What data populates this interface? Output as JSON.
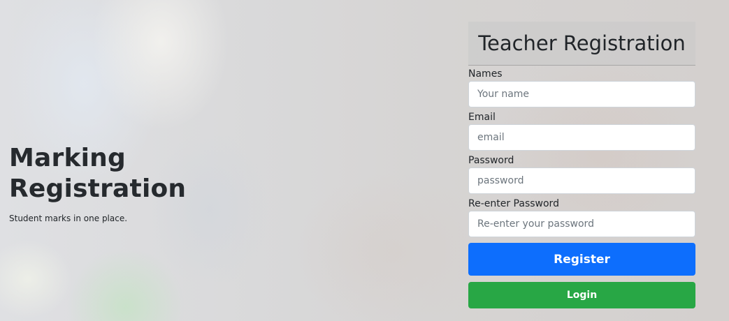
{
  "hero": {
    "title": "Marking Registration",
    "subtitle": "Student marks in one place."
  },
  "form": {
    "title": "Teacher Registration",
    "fields": [
      {
        "label": "Names",
        "placeholder": "Your name",
        "value": ""
      },
      {
        "label": "Email",
        "placeholder": "email",
        "value": ""
      },
      {
        "label": "Password",
        "placeholder": "password",
        "value": ""
      },
      {
        "label": "Re-enter Password",
        "placeholder": "Re-enter your password",
        "value": ""
      }
    ],
    "register_label": "Register",
    "login_label": "Login"
  },
  "colors": {
    "register_button": "#0d6efd",
    "login_button": "#28a745",
    "text": "#212529"
  }
}
